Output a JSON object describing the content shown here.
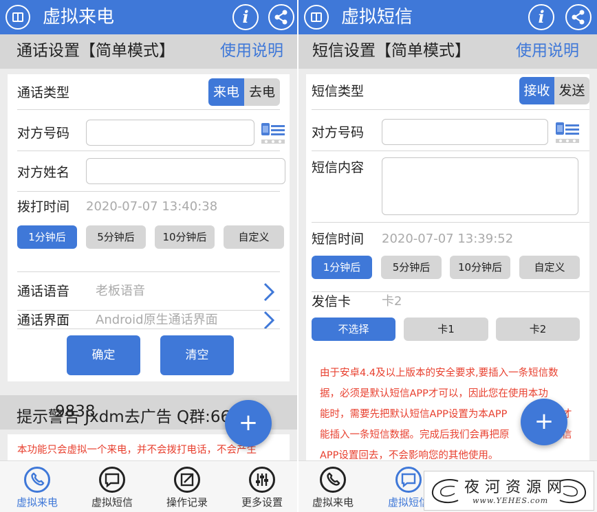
{
  "left": {
    "header": {
      "title": "虚拟来电"
    },
    "subheader": {
      "title": "通话设置【简单模式】",
      "help": "使用说明"
    },
    "call_type": {
      "label": "通话类型",
      "options": [
        "来电",
        "去电"
      ],
      "selected": "来电"
    },
    "number": {
      "label": "对方号码",
      "value": ""
    },
    "name": {
      "label": "对方姓名",
      "value": ""
    },
    "dial_time": {
      "label": "拨打时间",
      "value": "2020-07-07 13:40:38"
    },
    "delay_options": [
      "1分钟后",
      "5分钟后",
      "10分钟后",
      "自定义"
    ],
    "voice": {
      "label": "通话语音",
      "value": "老板语音"
    },
    "ui": {
      "label": "通话界面",
      "value": "Android原生通话界面"
    },
    "buttons": {
      "confirm": "确定",
      "clear": "清空"
    },
    "warning_bar": "提示警告 Jxdm去广告 Q群:66",
    "warning_bar_tail": "9838",
    "notice": "本功能只会虚拟一个来电，并不会拨打电话，不会产生"
  },
  "right": {
    "header": {
      "title": "虚拟短信"
    },
    "subheader": {
      "title": "短信设置【简单模式】",
      "help": "使用说明"
    },
    "sms_type": {
      "label": "短信类型",
      "options": [
        "接收",
        "发送"
      ],
      "selected": "接收"
    },
    "number": {
      "label": "对方号码",
      "value": ""
    },
    "content": {
      "label": "短信内容",
      "value": ""
    },
    "sms_time": {
      "label": "短信时间",
      "value": "2020-07-07 13:39:52"
    },
    "delay_options": [
      "1分钟后",
      "5分钟后",
      "10分钟后",
      "自定义"
    ],
    "sim": {
      "label": "发信卡",
      "value": "卡2"
    },
    "sim_options": [
      "不选择",
      "卡1",
      "卡2"
    ],
    "notice_lines": [
      "由于安卓4.4及以上版本的安全要求,要插入一条短信数",
      "据，必须是默认短信APP才可以，因此您在使用本功",
      "能时，需要先把默认短信APP设置为本APP",
      "能插入一条短信数据。完成后我们会再把原",
      "APP设置回去，不会影响您的其他使用。"
    ],
    "notice_tail_3": "才",
    "notice_tail_4": "信"
  },
  "nav": [
    "虚拟来电",
    "虚拟短信",
    "操作记录",
    "更多设置"
  ],
  "watermark": {
    "cn": "夜河资源网",
    "en": "www.YEHES.com"
  },
  "colors": {
    "primary": "#3f78d8",
    "warning": "#e8402f",
    "bar_gray": "#d6d6d6"
  }
}
